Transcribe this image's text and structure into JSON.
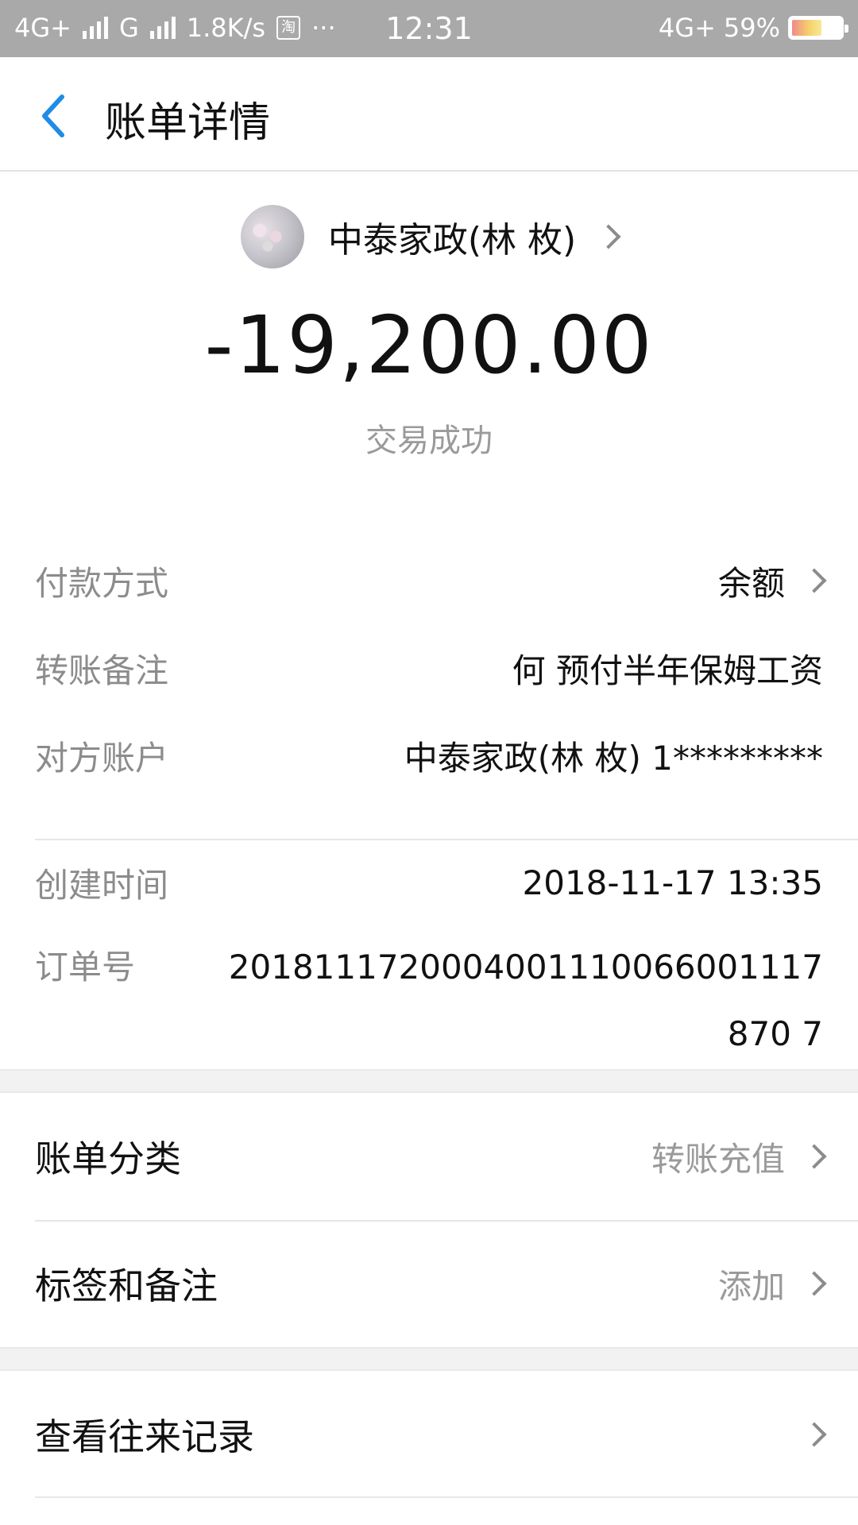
{
  "status_bar": {
    "left": [
      "4G+",
      "G",
      "1.8K/s"
    ],
    "app_glyph": "淘",
    "dots": "···",
    "time": "12:31",
    "network_right": "4G+",
    "battery": "59%",
    "battery_level": 0.59
  },
  "nav": {
    "title": "账单详情",
    "back_icon": "chevron-left-icon"
  },
  "summary": {
    "payee": "中泰家政(林   枚)",
    "amount": "-19,200.00",
    "status": "交易成功"
  },
  "details": {
    "payment_method": {
      "label": "付款方式",
      "value": "余额"
    },
    "transfer_note": {
      "label": "转账备注",
      "value": "何   预付半年保姆工资"
    },
    "counterparty": {
      "label": "对方账户",
      "value": "中泰家政(林   枚) 1*********"
    },
    "created_time": {
      "label": "创建时间",
      "value": "2018-11-17 13:35"
    },
    "order_no": {
      "label": "订单号",
      "value": "2018111720004001110066001117870 7"
    }
  },
  "menu": {
    "category": {
      "label": "账单分类",
      "value": "转账充值"
    },
    "tags": {
      "label": "标签和备注",
      "value": "添加"
    },
    "history": {
      "label": "查看往来记录"
    }
  },
  "colors": {
    "accent_blue": "#1f8ce6",
    "status_bar_bg": "#a9a9a9",
    "muted_text": "#8c8c8c"
  }
}
